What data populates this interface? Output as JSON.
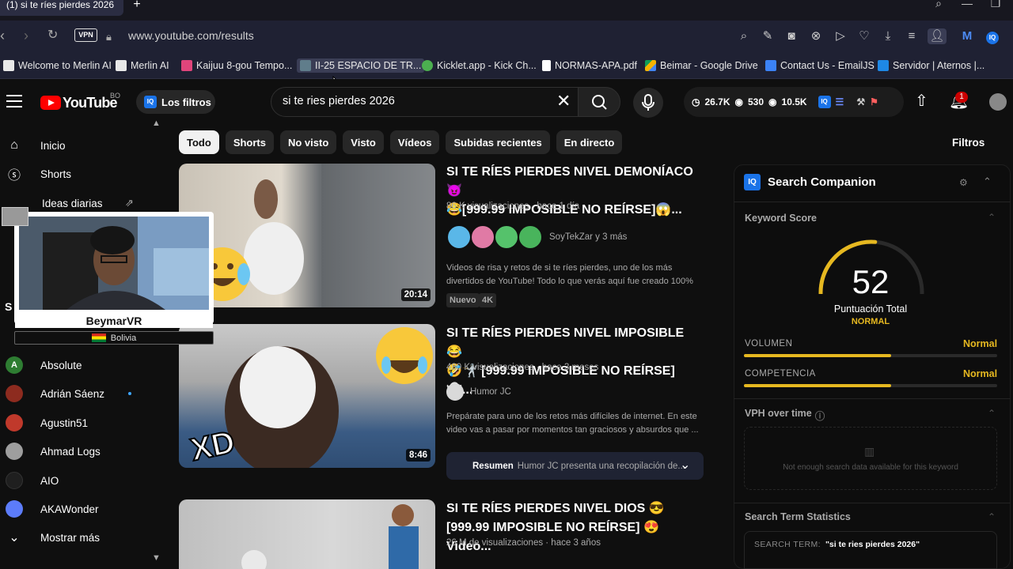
{
  "browser": {
    "tab_title": "(1) si te ríes pierdes 2026",
    "url": "www.youtube.com/results",
    "vpn_label": "VPN",
    "bookmarks": [
      {
        "label": "Welcome to Merlin AI",
        "icon": "merlin-icon",
        "color": "#6e40c9"
      },
      {
        "label": "Merlin AI",
        "icon": "merlin-icon",
        "color": "#8b5cf6"
      },
      {
        "label": "Kaijuu 8-gou Tempo...",
        "icon": "kaijuu-icon",
        "color": "#e0457b"
      },
      {
        "label": "II-25 ESPACIO DE TR...",
        "icon": "classroom-icon",
        "color": "#607d8b"
      },
      {
        "label": "Kicklet.app - Kick Ch...",
        "icon": "kicklet-icon",
        "color": "#4caf50"
      },
      {
        "label": "NORMAS-APA.pdf",
        "icon": "document-icon",
        "color": "#ffffff"
      },
      {
        "label": "Beimar - Google Drive",
        "icon": "google-drive-icon",
        "color": "#f9ab00"
      },
      {
        "label": "Contact Us - EmailJS",
        "icon": "emailjs-icon",
        "color": "#3b82f6"
      },
      {
        "label": "Servidor | Aternos |...",
        "icon": "aternos-icon",
        "color": "#1e88e5"
      }
    ]
  },
  "youtube": {
    "logo_text": "YouTube",
    "country_code": "BO",
    "filters_button": "Los filtros",
    "search_query": "si te ries pierdes 2026",
    "stats": {
      "views": "26.7K",
      "watching": "530",
      "other": "10.5K"
    },
    "notification_count": "1",
    "chips": [
      "Todo",
      "Shorts",
      "No visto",
      "Visto",
      "Vídeos",
      "Subidas recientes",
      "En directo"
    ],
    "filters_label": "Filtros",
    "sidebar": {
      "main": [
        {
          "label": "Inicio",
          "icon": "home-icon"
        },
        {
          "label": "Shorts",
          "icon": "shorts-icon"
        },
        {
          "label": "Ideas diarias",
          "icon": "ideas-icon"
        }
      ],
      "section_initial": "S",
      "subscriptions": [
        {
          "label": "Absolute",
          "color": "#2e7d32",
          "initial": "A"
        },
        {
          "label": "Adrián Sáenz",
          "color": "#8d2b1f",
          "initial": "",
          "dot": true
        },
        {
          "label": "Agustin51",
          "color": "#c0392b",
          "initial": ""
        },
        {
          "label": "Ahmad Logs",
          "color": "#9e9e9e",
          "initial": ""
        },
        {
          "label": "AIO",
          "color": "#1f1f1f",
          "initial": ""
        },
        {
          "label": "AKAWonder",
          "color": "#5c7cfa",
          "initial": ""
        }
      ],
      "show_more": "Mostrar más"
    },
    "videos": [
      {
        "title_line1": "SI TE RÍES PIERDES NIVEL DEMONÍACO 😈",
        "title_line2": "😂[999.99 IMPOSIBLE NO REÍRSE]😱...",
        "meta": "86 K visualizaciones · hace 1 día",
        "channel": "SoyTekZar y 3 más",
        "description_line1": "Videos de risa y retos de si te ríes pierdes, uno de los más",
        "description_line2": "divertidos de YouTube! Todo lo que verás aquí fue creado 100% ...",
        "badges": [
          "Nuevo",
          "4K"
        ],
        "duration": "20:14"
      },
      {
        "title_line1": "SI TE RÍES PIERDES NIVEL IMPOSIBLE 😂",
        "title_line2": "🤣🤺 [999.99 IMPOSIBLE NO REÍRSE]👻...",
        "meta": "480 K visualizaciones · hace 3 meses",
        "channel": "Humor JC",
        "description_line1": "Prepárate para uno de los retos más difíciles de internet. En este",
        "description_line2": "video vas a pasar por momentos tan graciosos y absurdos que ...",
        "duration": "8:46",
        "summary_label": "Resumen",
        "summary_text": "Humor JC presenta una recopilación de..."
      },
      {
        "title_line1": "SI TE RÍES PIERDES NIVEL DIOS 😎",
        "title_line2": "[999.99 IMPOSIBLE NO REÍRSE] 😍 Video...",
        "meta": "26 M de visualizaciones · hace 3 años"
      }
    ],
    "thumb_overlay_text": "XD"
  },
  "companion": {
    "title": "Search Companion",
    "keyword_score_label": "Keyword Score",
    "score": "52",
    "score_value": 52,
    "score_caption": "Puntuación Total",
    "score_rating": "NORMAL",
    "volume_label": "VOLUMEN",
    "volume_value": "Normal",
    "volume_fill": 0.58,
    "competition_label": "COMPETENCIA",
    "competition_value": "Normal",
    "competition_fill": 0.58,
    "vph_label": "VPH over time",
    "vph_empty": "Not enough search data available for this keyword",
    "stats_label": "Search Term Statistics",
    "search_term_label": "SEARCH TERM:",
    "search_term_value": "\"si te ries pierdes 2026\"",
    "accent": "#e6b820"
  },
  "webcam": {
    "name": "BeymarVR",
    "country": "Bolivia"
  }
}
